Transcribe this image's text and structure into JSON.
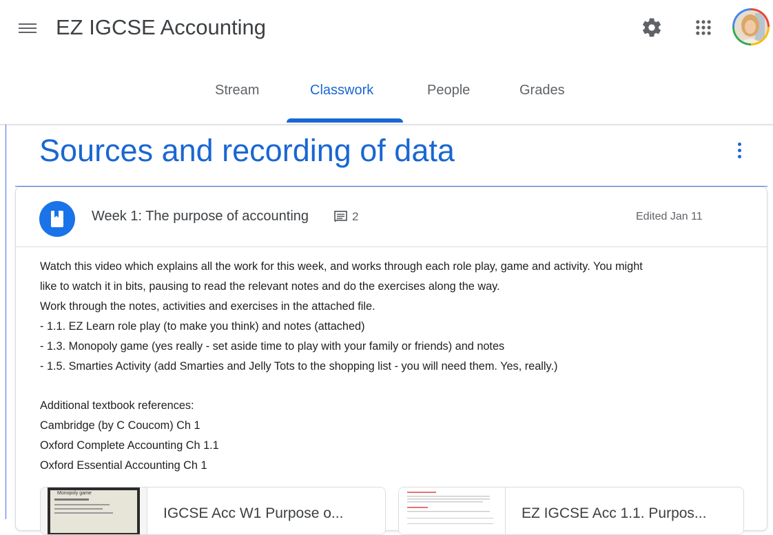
{
  "header": {
    "app_title": "EZ IGCSE Accounting",
    "icons": [
      "menu-icon",
      "gear-icon",
      "apps-grid-icon",
      "avatar"
    ]
  },
  "tabs": [
    {
      "label": "Stream",
      "active": false
    },
    {
      "label": "Classwork",
      "active": true
    },
    {
      "label": "People",
      "active": false
    },
    {
      "label": "Grades",
      "active": false
    }
  ],
  "section": {
    "title": "Sources and recording of data"
  },
  "assignment": {
    "title": "Week 1: The purpose of accounting",
    "comment_count": "2",
    "edited": "Edited Jan 11",
    "description_lines": [
      "Watch this video which explains all the work for this week, and works through each role play, game and activity. You might",
      "like to watch it in bits, pausing to read the relevant notes and do the exercises along the way.",
      "Work through the notes, activities and exercises in the attached file.",
      "- 1.1. EZ Learn role play (to make you think) and notes (attached)",
      "- 1.3. Monopoly game (yes really - set aside time to play with your family or friends) and notes",
      "- 1.5. Smarties Activity (add Smarties and Jelly Tots to the shopping list - you will need them. Yes, really.)",
      "",
      "Additional textbook references:",
      "Cambridge (by C Coucom) Ch 1",
      "Oxford Complete Accounting Ch 1.1",
      "Oxford Essential Accounting Ch 1"
    ],
    "attachments": [
      {
        "title": "IGCSE Acc W1 Purpose o...",
        "thumb_text": "Monopoly game"
      },
      {
        "title": "EZ IGCSE Acc 1.1. Purpos...",
        "thumb_text": ""
      }
    ]
  },
  "colors": {
    "accent": "#1967d2",
    "assignment_icon_bg": "#1a73e8",
    "divider": "#dadce0"
  }
}
